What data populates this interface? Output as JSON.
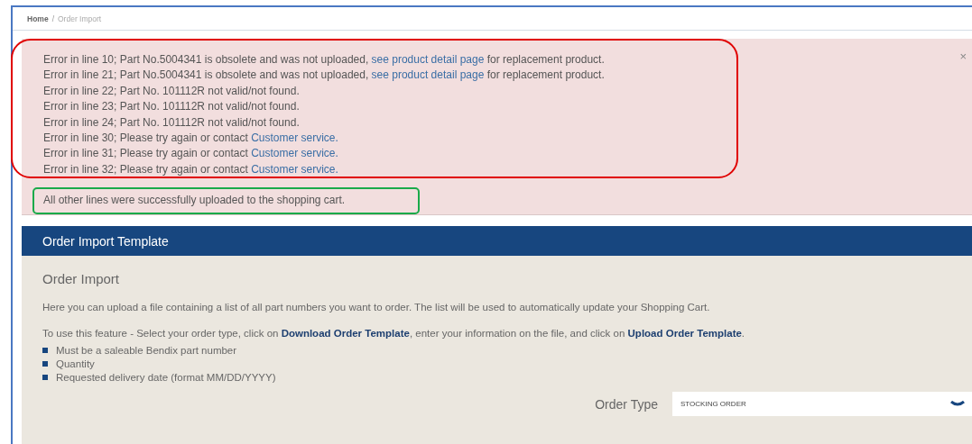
{
  "breadcrumb": [
    {
      "label": "Home",
      "current": false
    },
    {
      "label": "Order Import",
      "current": true
    }
  ],
  "breadcrumb_separator": "/",
  "alert": {
    "close": "×",
    "errors": [
      {
        "before": "Error in line 10; Part No.5004341 is obsolete and was not uploaded, ",
        "link": "see product detail page",
        "after": " for replacement product."
      },
      {
        "before": "Error in line 21; Part No.5004341 is obsolete and was not uploaded, ",
        "link": "see product detail page",
        "after": " for replacement product."
      },
      {
        "before": "Error in line 22; Part No. 101112R not valid/not found."
      },
      {
        "before": "Error in line 23; Part No. 101112R not valid/not found."
      },
      {
        "before": "Error in line 24; Part No. 101112R not valid/not found."
      },
      {
        "before": "Error in line 30; Please try again or contact ",
        "link": "Customer service."
      },
      {
        "before": "Error in line 31; Please try again or contact ",
        "link": "Customer service."
      },
      {
        "before": "Error in line 32; Please try again or contact ",
        "link": "Customer service."
      }
    ],
    "success": "All other lines were successfully uploaded to the shopping cart."
  },
  "panel": {
    "title": "Order Import Template",
    "subtitle": "Order Import",
    "intro": "Here you can upload a file containing a list of all part numbers you want to order. The list will be used to automatically update your Shopping Cart.",
    "instructions": [
      {
        "kind": "text",
        "text": "To use this feature - Select your order type, click on "
      },
      {
        "kind": "link",
        "text": "Download Order Template"
      },
      {
        "kind": "text",
        "text": ", enter your information on the file, and click on "
      },
      {
        "kind": "link",
        "text": "Upload Order Template"
      },
      {
        "kind": "text",
        "text": "."
      }
    ],
    "requirements": [
      "Must be a saleable Bendix part number",
      "Quantity",
      "Requested delivery date (format MM/DD/YYYY)"
    ],
    "order_type": {
      "label": "Order Type",
      "value": "STOCKING ORDER"
    }
  }
}
